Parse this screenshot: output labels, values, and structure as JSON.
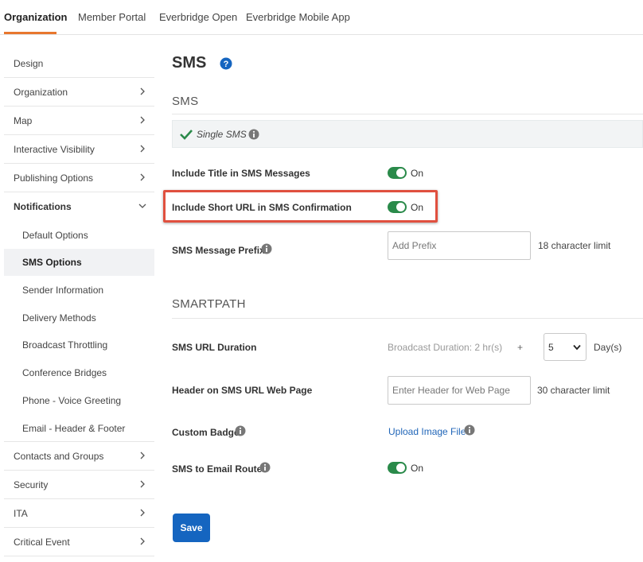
{
  "tabs": [
    {
      "label": "Organization",
      "active": true
    },
    {
      "label": "Member Portal",
      "active": false
    },
    {
      "label": "Everbridge Open",
      "active": false
    },
    {
      "label": "Everbridge Mobile App",
      "active": false
    }
  ],
  "sidebar": {
    "items": [
      {
        "label": "Design"
      },
      {
        "label": "Organization"
      },
      {
        "label": "Map"
      },
      {
        "label": "Interactive Visibility"
      },
      {
        "label": "Publishing Options"
      },
      {
        "label": "Notifications"
      }
    ],
    "sub_items": [
      {
        "label": "Default Options"
      },
      {
        "label": "SMS Options"
      },
      {
        "label": "Sender Information"
      },
      {
        "label": "Delivery Methods"
      },
      {
        "label": "Broadcast Throttling"
      },
      {
        "label": "Conference Bridges"
      },
      {
        "label": "Phone - Voice Greeting"
      },
      {
        "label": "Email - Header & Footer"
      }
    ],
    "items_after": [
      {
        "label": "Contacts and Groups"
      },
      {
        "label": "Security"
      },
      {
        "label": "ITA"
      },
      {
        "label": "Critical Event"
      }
    ]
  },
  "main": {
    "title": "SMS",
    "sms_section_title": "SMS",
    "single_sms_label": "Single SMS",
    "include_title": {
      "label": "Include Title in SMS Messages",
      "state": "On"
    },
    "include_short_url": {
      "label": "Include Short URL in SMS Confirmation",
      "state": "On"
    },
    "prefix": {
      "label": "SMS Message Prefix",
      "placeholder": "Add Prefix",
      "hint": "18 character limit"
    },
    "smartpath_section_title": "SMARTPATH",
    "url_duration": {
      "label": "SMS URL Duration",
      "broadcast": "Broadcast Duration: 2 hr(s)",
      "plus": "+",
      "value": "5",
      "unit": "Day(s)"
    },
    "header_web": {
      "label": "Header on SMS URL Web Page",
      "placeholder": "Enter Header for Web Page",
      "hint": "30 character limit"
    },
    "badge": {
      "label": "Custom Badge",
      "link": "Upload Image File"
    },
    "email_router": {
      "label": "SMS to Email Router",
      "state": "On"
    },
    "save_label": "Save"
  },
  "colors": {
    "accent_orange": "#e8772e",
    "toggle_green": "#2a8a4a",
    "primary_blue": "#1565c0",
    "highlight_red": "#e0503f"
  }
}
